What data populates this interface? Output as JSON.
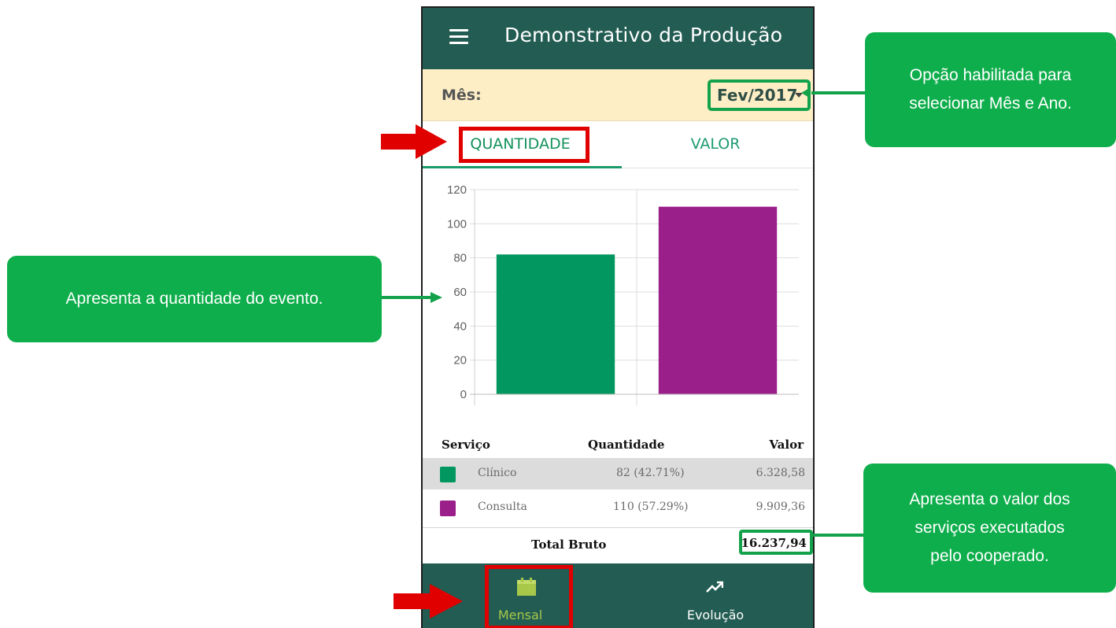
{
  "app": {
    "title": "Demonstrativo da Produção"
  },
  "month": {
    "label": "Mês:",
    "selected": "Fev/2017"
  },
  "tabs": [
    {
      "label": "QUANTIDADE",
      "active": true
    },
    {
      "label": "VALOR",
      "active": false
    }
  ],
  "chart_data": {
    "type": "bar",
    "categories": [
      "Clínico",
      "Consulta"
    ],
    "values": [
      82,
      110
    ],
    "colors": [
      "#029760",
      "#9b1f8a"
    ],
    "ylim": [
      0,
      120
    ],
    "yticks": [
      0,
      20,
      40,
      60,
      80,
      100,
      120
    ],
    "grid": true,
    "title": "",
    "xlabel": "",
    "ylabel": ""
  },
  "table": {
    "headers": {
      "service": "Serviço",
      "quantity": "Quantidade",
      "value": "Valor"
    },
    "rows": [
      {
        "service": "Clínico",
        "quantity": "82 (42.71%)",
        "value": "6.328,58",
        "color": "#029760"
      },
      {
        "service": "Consulta",
        "quantity": "110 (57.29%)",
        "value": "9.909,36",
        "color": "#9b1f8a"
      }
    ],
    "total_label": "Total Bruto",
    "total_value": "16.237,94"
  },
  "bottom_nav": [
    {
      "label": "Mensal",
      "icon": "calendar-icon",
      "active": true
    },
    {
      "label": "Evolução",
      "icon": "trending-up-icon",
      "active": false
    }
  ],
  "callouts": {
    "month": [
      "Opção habilitada para",
      "selecionar Mês e Ano."
    ],
    "quantity": "Apresenta a quantidade do evento.",
    "value": [
      "Apresenta o valor dos",
      "serviços executados",
      "pelo cooperado."
    ]
  },
  "colors": {
    "appbar": "#225c52",
    "callout": "#0fae4c",
    "highlight_red": "#e00000",
    "accent_green": "#13a24b"
  }
}
